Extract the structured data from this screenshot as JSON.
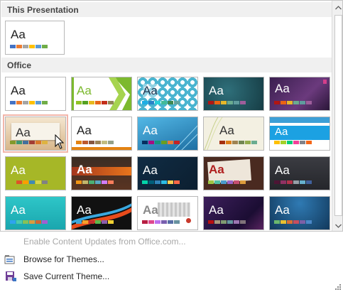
{
  "gallery": {
    "sections": {
      "this_presentation": "This Presentation",
      "office": "Office"
    },
    "aa_text": "Aa",
    "themes": [
      {
        "id": "current",
        "aa_color": "#222222",
        "bg": "#ffffff",
        "colors": [
          "#4472c4",
          "#ed7d31",
          "#a5a5a5",
          "#ffc000",
          "#5b9bd5",
          "#70ad47"
        ]
      },
      {
        "id": "office-theme",
        "aa_color": "#222222",
        "bg": "#ffffff",
        "colors": [
          "#4472c4",
          "#ed7d31",
          "#a5a5a5",
          "#ffc000",
          "#5b9bd5",
          "#70ad47"
        ]
      },
      {
        "id": "facet",
        "aa_color": "#7cb92e",
        "bg": "#ffffff",
        "accent": "#7cb92e",
        "colors": [
          "#90c226",
          "#54a021",
          "#e6b91e",
          "#e76618",
          "#c42f1a",
          "#918655"
        ]
      },
      {
        "id": "integral",
        "aa_color": "#1f3a55",
        "bg": "#4ab4d0",
        "colors": [
          "#1cade4",
          "#2683c6",
          "#27ced7",
          "#42ba97",
          "#3e8853",
          "#62a39f"
        ]
      },
      {
        "id": "ion-boardroom",
        "aa_color": "#ffffff",
        "bg": "#1f4f59",
        "colors": [
          "#b01513",
          "#ea6312",
          "#e6b729",
          "#6aac90",
          "#5f9c9d",
          "#9e5e9b"
        ]
      },
      {
        "id": "ion",
        "aa_color": "#ffffff",
        "bg": "#4a2a5a",
        "colors": [
          "#b01513",
          "#ea6312",
          "#e6b729",
          "#6aac90",
          "#5f9c9d",
          "#9e5e9b"
        ]
      },
      {
        "id": "organic",
        "aa_color": "#333333",
        "bg": "#e9d6b9",
        "colors": [
          "#83992a",
          "#3c9770",
          "#44709d",
          "#a23c33",
          "#d97828",
          "#deb340"
        ]
      },
      {
        "id": "retrospect",
        "aa_color": "#222222",
        "bg": "#ffffff",
        "colors": [
          "#e48312",
          "#bd582c",
          "#865640",
          "#9b8357",
          "#c2bc80",
          "#94a088"
        ]
      },
      {
        "id": "slice",
        "aa_color": "#ffffff",
        "bg": "#2e8fc2",
        "colors": [
          "#052f61",
          "#a50e82",
          "#14967c",
          "#6a9e1f",
          "#e87d37",
          "#c62324"
        ]
      },
      {
        "id": "wisp",
        "aa_color": "#333333",
        "bg": "#f3f0e2",
        "colors": [
          "#a53010",
          "#de7e18",
          "#9f8351",
          "#728653",
          "#92aa4c",
          "#6aac91"
        ]
      },
      {
        "id": "banded",
        "aa_color": "#ffffff",
        "bg": "#ffffff",
        "colors": [
          "#ffc000",
          "#a5d028",
          "#08cc78",
          "#f24099",
          "#828288",
          "#f56617"
        ]
      },
      {
        "id": "basis",
        "aa_color": "#ffffff",
        "bg": "#a6b727",
        "colors": [
          "#a6b727",
          "#df5327",
          "#fe9e00",
          "#418ab3",
          "#d7d447",
          "#818183"
        ]
      },
      {
        "id": "berlin",
        "aa_color": "#ffffff",
        "bg": "#3b2d24",
        "colors": [
          "#f09415",
          "#c1b56b",
          "#4baf73",
          "#5aa6c0",
          "#d17df9",
          "#fa7e5c"
        ]
      },
      {
        "id": "circuit",
        "aa_color": "#ffffff",
        "bg": "#0e2841",
        "colors": [
          "#03d4a8",
          "#005e7a",
          "#2f81b7",
          "#2cbbe3",
          "#f9cd51",
          "#f96746"
        ]
      },
      {
        "id": "damask",
        "aa_color": "#b01e1e",
        "bg": "#eae0d4",
        "colors": [
          "#9ec544",
          "#50bea3",
          "#4a9ccc",
          "#9a66ca",
          "#c54f71",
          "#de9c3c"
        ]
      },
      {
        "id": "dividend",
        "aa_color": "#ffffff",
        "bg": "#2f3035",
        "colors": [
          "#4d1434",
          "#903163",
          "#b2324b",
          "#969fa7",
          "#66b1ce",
          "#40619d"
        ]
      },
      {
        "id": "droplet",
        "aa_color": "#ffffff",
        "bg": "#27c1c5",
        "colors": [
          "#2fa3ee",
          "#4bcaad",
          "#86c157",
          "#d99c3f",
          "#ce6633",
          "#a35dd1"
        ]
      },
      {
        "id": "frame",
        "aa_color": "#ffffff",
        "bg": "#1c1c1c",
        "colors": [
          "#40a5d6",
          "#f5a12b",
          "#c12e2e",
          "#5bb84d",
          "#8b5dac",
          "#f4d233"
        ]
      },
      {
        "id": "gallery",
        "aa_color": "#8a8a8a",
        "bg": "#ffffff",
        "colors": [
          "#b71e42",
          "#de478e",
          "#bc72f0",
          "#795faf",
          "#586ea6",
          "#6892a0"
        ]
      },
      {
        "id": "main-event",
        "aa_color": "#ffffff",
        "bg": "#2b1a4f",
        "colors": [
          "#b80e0f",
          "#a6987d",
          "#7f9a71",
          "#64969f",
          "#9b75b2",
          "#80737a"
        ]
      },
      {
        "id": "mesh",
        "aa_color": "#ffffff",
        "bg": "#1b5b8a",
        "colors": [
          "#6bb76d",
          "#e8c030",
          "#da6f31",
          "#c64e5f",
          "#7c60a6",
          "#4c88c8"
        ]
      }
    ]
  },
  "menu": {
    "enable_updates": "Enable Content Updates from Office.com...",
    "browse_themes": "Browse for Themes...",
    "save_theme": "Save Current Theme..."
  },
  "colors": {
    "section_bg": "#f0f0f0",
    "border": "#c6c6c6",
    "hover_outline": "#f2b6aa",
    "disabled_text": "#a8a8a8"
  },
  "icons": {
    "browse_themes": "folder-open-icon",
    "save_theme": "save-disk-icon",
    "scroll_up": "chevron-up-icon",
    "scroll_down": "chevron-down-icon",
    "resize": "resize-grip-icon"
  }
}
